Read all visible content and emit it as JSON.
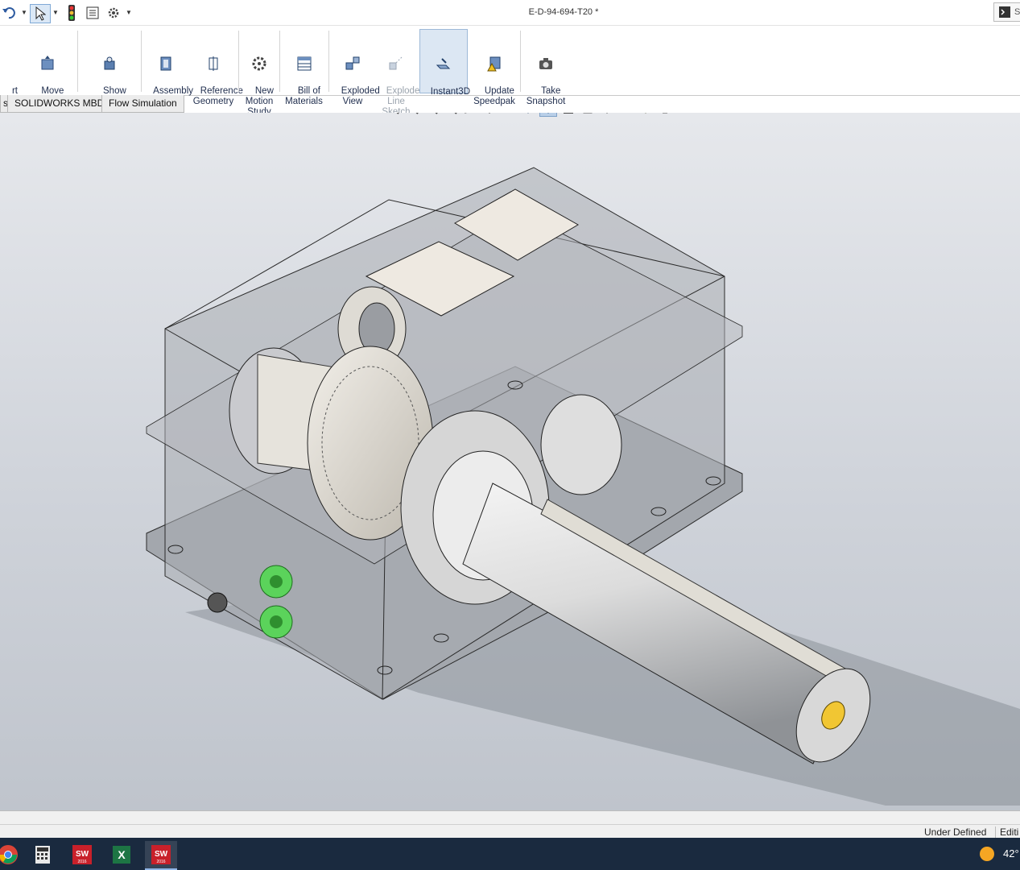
{
  "window": {
    "title": "E-D-94-694-T20 *",
    "search_fragment": "S"
  },
  "quick_access": {
    "icons": [
      "undo-icon",
      "select-cursor-icon",
      "rebuild-traffic-light-icon",
      "file-properties-icon",
      "options-gear-icon"
    ]
  },
  "ribbon": {
    "buttons": [
      {
        "id": "smart-fasteners",
        "label": "rt\nners",
        "icon": "smart-fasteners-icon",
        "enabled": true
      },
      {
        "id": "move-component",
        "label": "Move\nComponent",
        "icon": "move-component-icon",
        "enabled": true,
        "dropdown": true
      },
      {
        "id": "show-hidden",
        "label": "Show\nHidden\nComponents",
        "icon": "show-hidden-icon",
        "enabled": true
      },
      {
        "id": "assembly-features",
        "label": "Assembly\nFeatures",
        "icon": "assembly-features-icon",
        "enabled": true,
        "dropdown": true
      },
      {
        "id": "reference-geometry",
        "label": "Reference\nGeometry",
        "icon": "reference-geometry-icon",
        "enabled": true,
        "dropdown": true
      },
      {
        "id": "new-motion-study",
        "label": "New\nMotion\nStudy",
        "icon": "motion-study-icon",
        "enabled": true
      },
      {
        "id": "bill-of-materials",
        "label": "Bill of\nMaterials",
        "icon": "bom-icon",
        "enabled": true
      },
      {
        "id": "exploded-view",
        "label": "Exploded\nView",
        "icon": "exploded-view-icon",
        "enabled": true
      },
      {
        "id": "explode-line-sketch",
        "label": "Explode\nLine\nSketch",
        "icon": "explode-line-icon",
        "enabled": false
      },
      {
        "id": "instant3d",
        "label": "Instant3D",
        "icon": "instant3d-icon",
        "enabled": true,
        "active": true
      },
      {
        "id": "update-speedpak",
        "label": "Update\nSpeedpak",
        "icon": "speedpak-icon",
        "enabled": true
      },
      {
        "id": "take-snapshot",
        "label": "Take\nSnapshot",
        "icon": "camera-icon",
        "enabled": true
      }
    ]
  },
  "tabs": [
    {
      "label": "s"
    },
    {
      "label": "SOLIDWORKS MBD"
    },
    {
      "label": "Flow Simulation"
    }
  ],
  "heads_up_toolbar": {
    "icons": [
      "zoom-to-fit-icon",
      "zoom-area-icon",
      "zoom-icon",
      "zoom-selection-icon",
      "previous-view-icon",
      "section-view-icon",
      "dynamic-annotation-icon",
      "view-orientation-icon",
      "display-style-icon",
      "hide-show-icon",
      "edit-appearance-icon",
      "scene-icon",
      "view-settings-icon",
      "display-pane-icon"
    ]
  },
  "status": {
    "definition": "Under Defined",
    "editing": "Editi"
  },
  "taskbar": {
    "apps": [
      {
        "name": "chrome-icon",
        "label": ""
      },
      {
        "name": "calculator-icon",
        "label": ""
      },
      {
        "name": "solidworks-icon",
        "label": "SW 2016"
      },
      {
        "name": "excel-icon",
        "label": ""
      },
      {
        "name": "solidworks-icon-active",
        "label": "SW 2016"
      }
    ],
    "weather_temp": "42°"
  },
  "colors": {
    "accent": "#2c5aa0",
    "taskbar": "#1a2a3f",
    "solidworks_red": "#c8202a",
    "housing": "#a4a8ae",
    "fitting_green": "#5bd35b"
  }
}
